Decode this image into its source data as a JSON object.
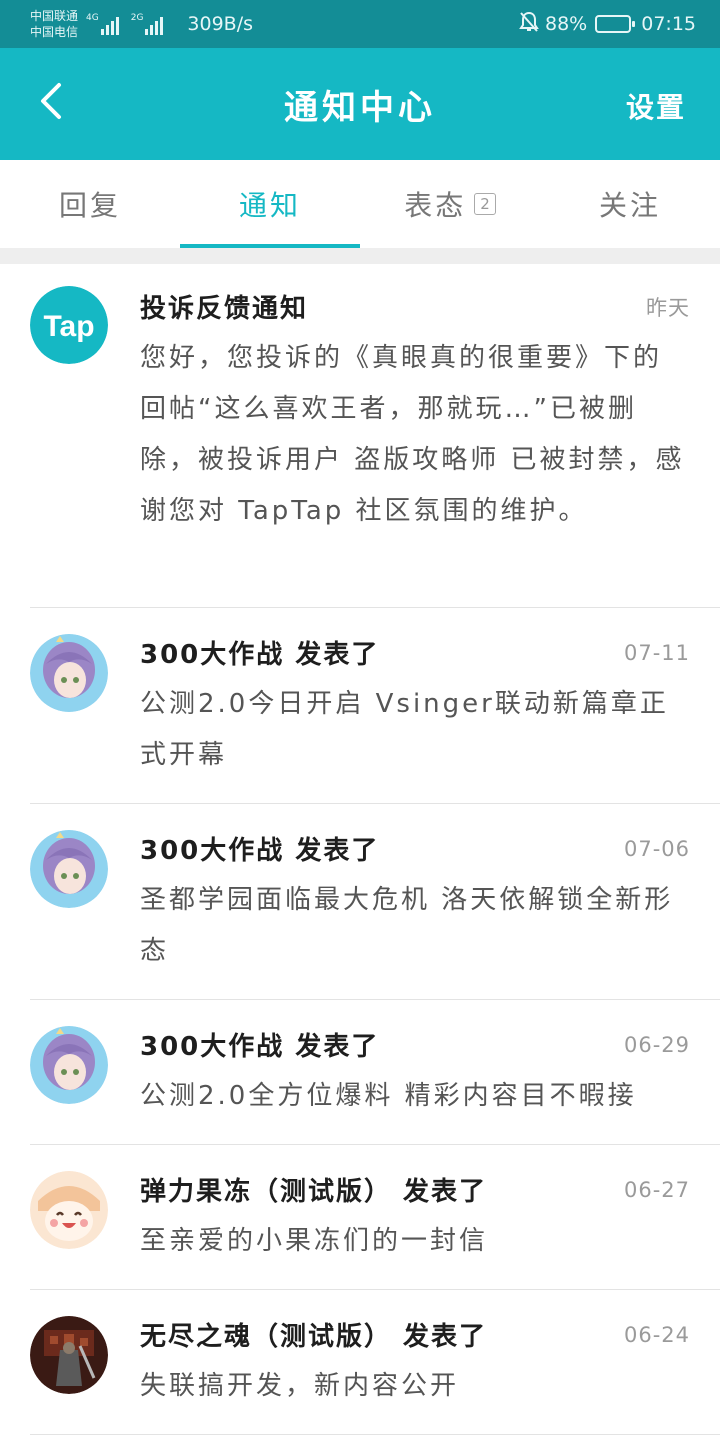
{
  "status_bar": {
    "carrier_1": "中国联通",
    "carrier_2": "中国电信",
    "net_1": "4G",
    "net_2": "2G",
    "net_speed": "309B/s",
    "battery": "88%",
    "battery_level": 0.88,
    "time": "07:15"
  },
  "header": {
    "back_icon": "chevron-left-icon",
    "title": "通知中心",
    "settings_label": "设置"
  },
  "tabs": [
    {
      "label": "回复",
      "active": false
    },
    {
      "label": "通知",
      "active": true
    },
    {
      "label": "表态",
      "badge": "2",
      "active": false
    },
    {
      "label": "关注",
      "active": false
    }
  ],
  "notifications": [
    {
      "title": "投诉反馈通知",
      "date": "昨天",
      "body": "您好，您投诉的《真眼真的很重要》下的回帖“这么喜欢王者，那就玩…”已被删除，被投诉用户 盗版攻略师 已被封禁，感谢您对 TapTap 社区氛围的维护。",
      "avatar": "taptap-logo"
    },
    {
      "title": "300大作战 发表了",
      "date": "07-11",
      "body": "公测2.0今日开启 Vsinger联动新篇章正式开幕",
      "avatar": "anime-girl-avatar"
    },
    {
      "title": "300大作战 发表了",
      "date": "07-06",
      "body": "圣都学园面临最大危机 洛天依解锁全新形态",
      "avatar": "anime-girl-avatar"
    },
    {
      "title": "300大作战 发表了",
      "date": "06-29",
      "body": "公测2.0全方位爆料 精彩内容目不暇接",
      "avatar": "anime-girl-avatar"
    },
    {
      "title": "弹力果冻（测试版） 发表了",
      "date": "06-27",
      "body": "至亲爱的小果冻们的一封信",
      "avatar": "jelly-avatar"
    },
    {
      "title": "无尽之魂（测试版） 发表了",
      "date": "06-24",
      "body": "失联搞开发，新内容公开",
      "avatar": "warrior-avatar"
    }
  ],
  "colors": {
    "accent": "#15b8c4",
    "status_bar": "#138d96",
    "divider": "#e3e3e3"
  }
}
